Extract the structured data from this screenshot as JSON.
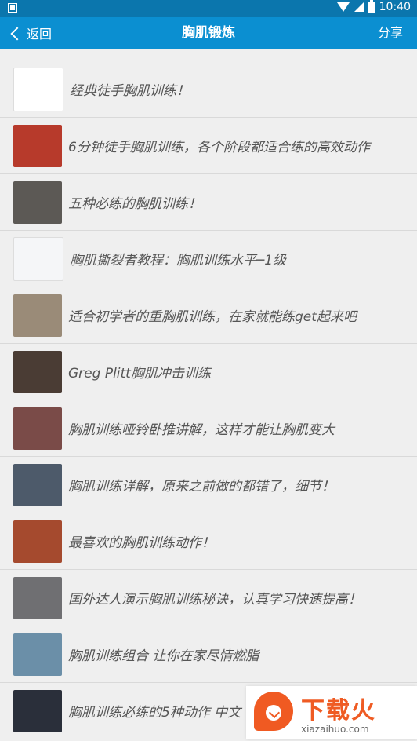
{
  "status_bar": {
    "time": "10:40"
  },
  "header": {
    "back_label": "返回",
    "title": "胸肌锻炼",
    "share_label": "分享"
  },
  "items": [
    {
      "title": "经典徒手胸肌训练！",
      "thumb_color": "#ffffff"
    },
    {
      "title": "6分钟徒手胸肌训练，各个阶段都适合练的高效动作",
      "thumb_color": "#b73a2b"
    },
    {
      "title": "五种必练的胸肌训练！",
      "thumb_color": "#5c5955"
    },
    {
      "title": "胸肌撕裂者教程：胸肌训练水平─1级",
      "thumb_color": "#f5f6f8"
    },
    {
      "title": "适合初学者的重胸肌训练，在家就能练get起来吧",
      "thumb_color": "#9a8b78"
    },
    {
      "title": "Greg Plitt胸肌冲击训练",
      "thumb_color": "#4a3c34"
    },
    {
      "title": "胸肌训练哑铃卧推讲解，这样才能让胸肌变大",
      "thumb_color": "#7a4b48"
    },
    {
      "title": "胸肌训练详解，原来之前做的都错了，细节！",
      "thumb_color": "#4d5a6a"
    },
    {
      "title": "最喜欢的胸肌训练动作！",
      "thumb_color": "#a54a2e"
    },
    {
      "title": "国外达人演示胸肌训练秘诀，认真学习快速提高！",
      "thumb_color": "#6f6f72"
    },
    {
      "title": "胸肌训练组合 让你在家尽情燃脂",
      "thumb_color": "#6b8fa8"
    },
    {
      "title": "胸肌训练必练的5种动作 中文",
      "thumb_color": "#2a2f3a"
    }
  ],
  "watermark": {
    "cn": "下载火",
    "en": "xiazaihuo.com"
  },
  "colors": {
    "nav_bg": "#0b8fd1",
    "status_bg": "#0b76ad",
    "page_bg": "#efefef",
    "text": "#555555"
  }
}
